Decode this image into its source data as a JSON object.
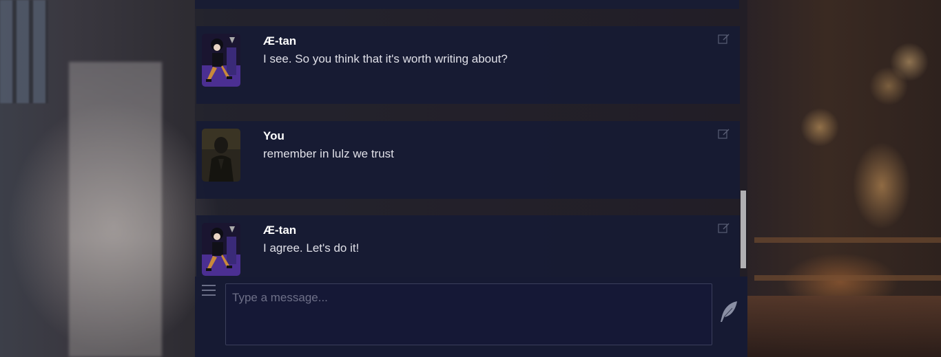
{
  "messages": [
    {
      "name": "Æ-tan",
      "text": "I see. So you think that it's worth writing about?",
      "avatar": "aetan-avatar"
    },
    {
      "name": "You",
      "text": "remember in lulz we trust",
      "avatar": "user-avatar"
    },
    {
      "name": "Æ-tan",
      "text": "I agree. Let's do it!",
      "avatar": "aetan-avatar"
    }
  ],
  "composer": {
    "placeholder": "Type a message...",
    "value": ""
  },
  "icons": {
    "edit": "edit-icon",
    "options": "hamburger-menu-icon",
    "send": "quill-feather-icon"
  },
  "colors": {
    "panel": "#171b34",
    "accent_purple": "#5a3fa8",
    "text": "#e0e0e8"
  }
}
